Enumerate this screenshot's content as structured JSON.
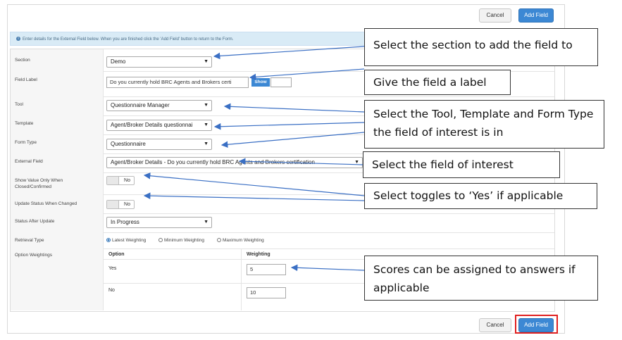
{
  "top_buttons": {
    "cancel": "Cancel",
    "add": "Add Field"
  },
  "info": "Enter details for the External Field below. When you are finished click the 'Add Field' button to return to the Form.",
  "fields": {
    "section": {
      "label": "Section",
      "value": "Demo"
    },
    "field_label": {
      "label": "Field Label",
      "value": "Do you currently hold BRC Agents and Brokers certi",
      "show": "Show"
    },
    "tool": {
      "label": "Tool",
      "value": "Questionnaire Manager"
    },
    "template": {
      "label": "Template",
      "value": "Agent/Broker Details questionnai"
    },
    "form_type": {
      "label": "Form Type",
      "value": "Questionnaire"
    },
    "external_field": {
      "label": "External Field",
      "value": "Agent/Broker Details - Do you currently hold BRC Agents and Brokers certification"
    },
    "show_value": {
      "label": "Show Value Only When Closed/Confirmed",
      "value": "No"
    },
    "update_status": {
      "label": "Update Status When Changed",
      "value": "No"
    },
    "status_after": {
      "label": "Status After Update",
      "value": "In Progress"
    },
    "retrieval": {
      "label": "Retrieval Type",
      "options": [
        "Latest Weighting",
        "Minimum Weighting",
        "Maximum Weighting"
      ],
      "selected": "Latest Weighting"
    },
    "weightings": {
      "label": "Option Weightings",
      "col_option": "Option",
      "col_weighting": "Weighting",
      "rows": [
        {
          "option": "Yes",
          "weight": "5"
        },
        {
          "option": "No",
          "weight": "10"
        }
      ]
    }
  },
  "bottom_buttons": {
    "cancel": "Cancel",
    "add": "Add Field"
  },
  "callouts": {
    "section": "Select the section to add the field to",
    "label": "Give the field a label",
    "tool": "Select the Tool, Template and Form Type the field of interest is in",
    "field": "Select the field of interest",
    "toggles": "Select toggles to ‘Yes’ if applicable",
    "scores": "Scores can be assigned to answers if applicable"
  },
  "colors": {
    "accent": "#3c88d4",
    "highlight": "#e02020",
    "arrow": "#3a6fc4"
  }
}
